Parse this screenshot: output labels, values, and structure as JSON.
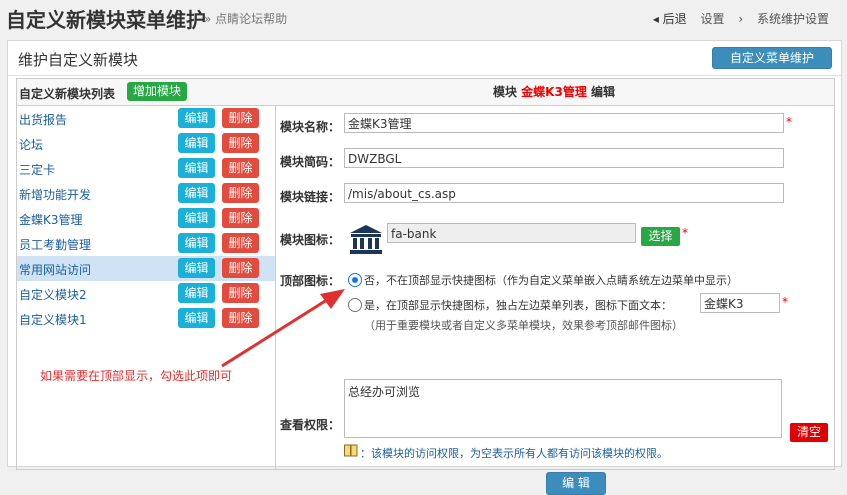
{
  "header": {
    "title": "自定义新模块菜单维护",
    "subtitle": "» 点睛论坛帮助",
    "nav_back": "◂ 后退",
    "nav_settings": "设置",
    "nav_sep": "›",
    "nav_system": "系统维护设置"
  },
  "panel": {
    "title": "维护自定义新模块",
    "menu_button": "自定义菜单维护"
  },
  "left": {
    "header_label": "自定义新模块列表",
    "add_button": "增加模块",
    "edit_label": "编辑",
    "delete_label": "删除",
    "modules": [
      "出货报告",
      "论坛",
      "三定卡",
      "新增功能开发",
      "金蝶K3管理",
      "员工考勤管理",
      "常用网站访问",
      "自定义模块2",
      "自定义模块1"
    ],
    "selected_index": 6
  },
  "right": {
    "header_prefix": "模块",
    "header_module": "金蝶K3管理",
    "header_suffix": "编辑",
    "fields": {
      "name_label": "模块名称：",
      "name_value": "金蝶K3管理",
      "short_label": "模块简码：",
      "short_value": "DWZBGL",
      "link_label": "模块链接：",
      "link_value": "/mis/about_cs.asp",
      "icon_label": "模块图标：",
      "icon_value": "fa-bank",
      "choose_button": "选择",
      "top_icon_label": "顶部图标：",
      "option_no": "否，不在顶部显示快捷图标（作为自定义菜单嵌入点睛系统左边菜单中显示）",
      "option_yes": "是，在顶部显示快捷图标，独占左边菜单列表，图标下面文本：",
      "option_yes_text_value": "金蝶K3",
      "option_yes_note": "（用于重要模块或者自定义多菜单模块，效果参考顶部邮件图标）",
      "permission_label": "查看权限：",
      "permission_value": "总经办可浏览",
      "clear_button": "清空",
      "hint": "：该模块的访问权限，为空表示所有人都有访问该模块的权限。",
      "submit_button": "编 辑",
      "required_mark": "*"
    },
    "top_icon_selected": "no"
  },
  "annotation": {
    "text": "如果需要在顶部显示，勾选此项即可"
  },
  "colors": {
    "accent": "#3c8dbc",
    "edit": "#1ab0d8",
    "delete": "#e14c3f",
    "add": "#28a745",
    "arrow": "#e03030"
  }
}
